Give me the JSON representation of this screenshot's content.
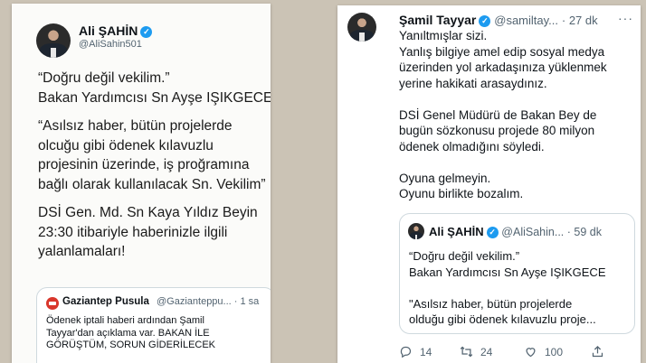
{
  "left_tweet": {
    "author_name": "Ali ŞAHİN",
    "author_handle": "@AliSahin501",
    "paragraphs": [
      "“Doğru değil vekilim.”\nBakan Yardımcısı Sn Ayşe IŞIKGECE",
      "“Asılsız haber, bütün projelerde\nolcuğu gibi ödenek kılavuzlu\nprojesinin üzerinde, iş proğramına\nbağlı olarak kullanılacak Sn. Vekilim”",
      "DSİ Gen. Md.  Sn Kaya Yıldız Beyin\n23:30 itibariyle haberinizle ilgili\nyalanlamaları!"
    ],
    "quoted": {
      "name": "Gaziantep Pusula",
      "handle": "@Gazianteppu... · 1 sa",
      "text": "Ödenek iptali haberi ardından Şamil\nTayyar'dan açıklama var. BAKAN İLE\nGÖRÜŞTÜM, SORUN GİDERİLECEK"
    }
  },
  "right_tweet": {
    "author_name": "Şamil Tayyar",
    "author_handle": "@samiltay...",
    "time": "· 27 dk",
    "more": "···",
    "paragraphs": [
      "Yanıltmışlar sizi.\nYanlış bilgiye amel edip sosyal medya\nüzerinden yol arkadaşınıza yüklenmek\nyerine hakikati arasaydınız.",
      "DSİ Genel Müdürü de Bakan Bey de\nbugün sözkonusu projede 80 milyon\nödenek olmadığını söyledi.",
      "Oyuna gelmeyin.\nOyunu birlikte bozalım."
    ],
    "quoted": {
      "name": "Ali ŞAHİN",
      "handle": "@AliSahin... · 59 dk",
      "paragraphs": [
        "“Doğru değil vekilim.”\nBakan Yardımcısı Sn Ayşe IŞIKGECE",
        "\"Asılsız haber, bütün projelerde\nolduğu gibi ödenek kılavuzlu proje..."
      ]
    },
    "actions": {
      "replies": "14",
      "retweets": "24",
      "likes": "100"
    }
  },
  "colors": {
    "background": "#cbc3b5",
    "verified": "#1d9bf0",
    "secondary_text": "#536471",
    "news_logo": "#d9362b"
  },
  "icons": [
    "verified-badge-icon",
    "reply-icon",
    "retweet-icon",
    "like-icon",
    "share-icon",
    "more-icon"
  ]
}
